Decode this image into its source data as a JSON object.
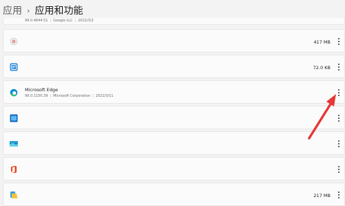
{
  "breadcrumb": {
    "parent": "应用",
    "separator": "›",
    "current": "应用和功能"
  },
  "top_partial_row": {
    "version": "99.0.4844.51",
    "publisher": "Google LLC",
    "date": "2022/3/2"
  },
  "apps": [
    {
      "icon": "generic-app-icon",
      "size": "417 MB"
    },
    {
      "icon": "blue-window-app-icon",
      "size": "72.0 KB"
    },
    {
      "icon": "edge-icon",
      "name": "Microsoft Edge",
      "version": "99.0.1150.39",
      "publisher": "Microsoft Corporation",
      "date": "2022/3/11"
    },
    {
      "icon": "window-app-icon"
    },
    {
      "icon": "photo-app-icon"
    },
    {
      "icon": "office-icon"
    },
    {
      "icon": "folder-app-icon",
      "size": "217 MB"
    }
  ],
  "colors": {
    "background": "#f3f3f3",
    "row": "#fbfbfb",
    "arrow": "#e53935",
    "accent": "#0078d4"
  }
}
